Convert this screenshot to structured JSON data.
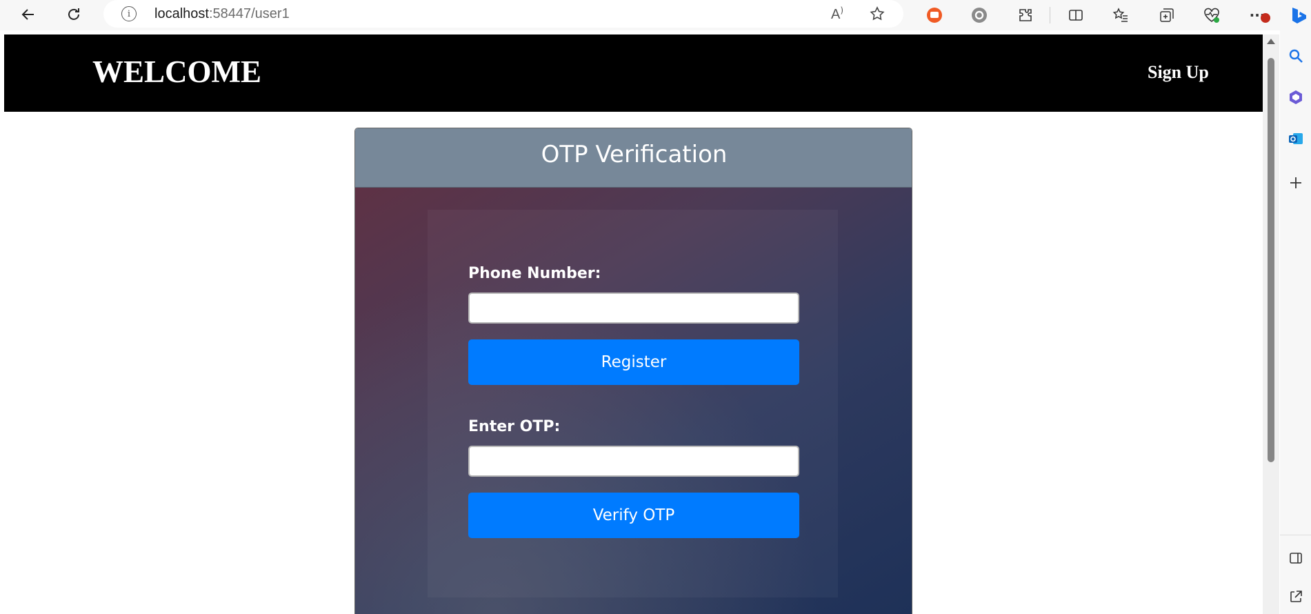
{
  "browser": {
    "url_host": "localhost",
    "url_rest": ":58447/user1",
    "icons": [
      "back-icon",
      "refresh-icon",
      "info-icon",
      "read-aloud-icon",
      "favorite-star-icon",
      "extension-red-icon",
      "settings-gear-icon",
      "extensions-puzzle-icon",
      "split-screen-icon",
      "favorites-icon",
      "collections-icon",
      "browser-essentials-icon",
      "more-icon",
      "copilot-icon"
    ],
    "read_aloud_glyph": "A",
    "more_glyph": "···"
  },
  "header": {
    "title": "WELCOME",
    "signup": "Sign Up",
    "background": "#000000"
  },
  "card": {
    "title": "OTP Verification",
    "header_color": "#778899",
    "phone_label": "Phone Number:",
    "phone_value": "",
    "register_label": "Register",
    "otp_label": "Enter OTP:",
    "otp_value": "",
    "verify_label": "Verify OTP",
    "button_color": "#007bff"
  }
}
